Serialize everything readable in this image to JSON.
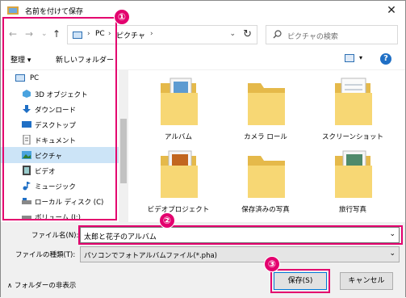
{
  "window": {
    "title": "名前を付けて保存",
    "close_glyph": "✕"
  },
  "nav": {
    "back_glyph": "←",
    "forward_glyph": "→",
    "recent_glyph": "⌄",
    "up_glyph": "↑",
    "address": {
      "crumbs": [
        "PC",
        "ピクチャ"
      ],
      "sep": "›",
      "dropdown": "⌄",
      "refresh": "↻"
    },
    "search_placeholder": "ピクチャの検索"
  },
  "toolbar": {
    "organize": "整理 ▾",
    "new_folder": "新しいフォルダー",
    "view_dd": "▾",
    "help": "?"
  },
  "sidebar": {
    "items": [
      {
        "label": "PC",
        "icon": "pc-icon"
      },
      {
        "label": "3D オブジェクト",
        "icon": "3d-objects-icon"
      },
      {
        "label": "ダウンロード",
        "icon": "download-icon"
      },
      {
        "label": "デスクトップ",
        "icon": "desktop-icon"
      },
      {
        "label": "ドキュメント",
        "icon": "document-icon"
      },
      {
        "label": "ピクチャ",
        "icon": "pictures-icon",
        "selected": true
      },
      {
        "label": "ビデオ",
        "icon": "video-icon"
      },
      {
        "label": "ミュージック",
        "icon": "music-icon"
      },
      {
        "label": "ローカル ディスク (C)",
        "icon": "disk-icon"
      },
      {
        "label": "ボリューム (I:)",
        "icon": "volume-icon"
      }
    ]
  },
  "files": {
    "items": [
      {
        "label": "アルバム",
        "icon": "folder-with-photos-icon"
      },
      {
        "label": "カメラ ロール",
        "icon": "folder-icon"
      },
      {
        "label": "スクリーンショット",
        "icon": "folder-with-documents-icon"
      },
      {
        "label": "ビデオプロジェクト",
        "icon": "folder-with-photos-icon"
      },
      {
        "label": "保存済みの写真",
        "icon": "folder-icon"
      },
      {
        "label": "旅行写真",
        "icon": "folder-with-photos-icon"
      }
    ]
  },
  "form": {
    "filename_label": "ファイル名(N):",
    "filename_value": "太郎と花子のアルバム",
    "filetype_label": "ファイルの種類(T):",
    "filetype_value": "パソコンでフォトアルバムファイル(*.pha)",
    "dd": "⌄"
  },
  "footer": {
    "hide_folders": "∧ フォルダーの非表示",
    "save": "保存(S)",
    "cancel": "キャンセル"
  },
  "annotations": {
    "one": "①",
    "two": "②",
    "three": "③"
  },
  "colors": {
    "accent": "#e3006e",
    "selection": "#cce4f7",
    "folder": "#f7d774"
  }
}
